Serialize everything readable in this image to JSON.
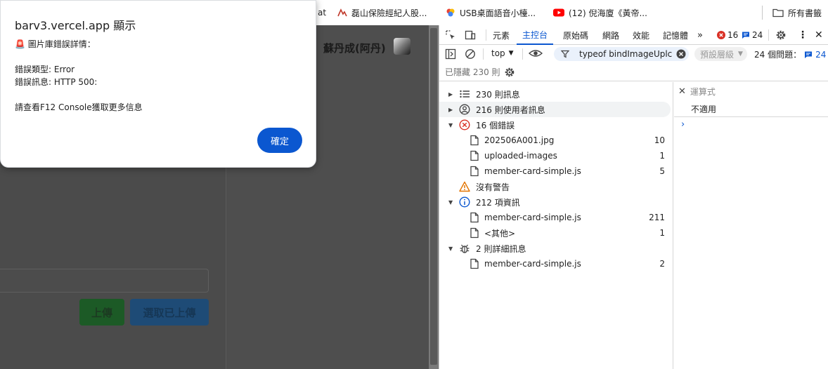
{
  "bookmarks": {
    "items": [
      {
        "label": "at"
      },
      {
        "label": "磊山保險經紀人股..."
      },
      {
        "label": "USB桌面語音小檯..."
      },
      {
        "label": "(12) 倪海廈《黃帝..."
      }
    ],
    "all_bookmarks": "所有書籤"
  },
  "page": {
    "user_name": "蘇丹成(阿丹)",
    "upload_label": "上傳",
    "choose_upload_label": "選取已上傳"
  },
  "dialog": {
    "title": "barv3.vercel.app 顯示",
    "line1": "🚨 圖片庫錯誤詳情：",
    "line2": "錯誤類型: Error",
    "line3": "錯誤訊息: HTTP 500:",
    "line4": "請查看F12 Console獲取更多信息",
    "ok_label": "確定"
  },
  "devtools": {
    "tabs": [
      "元素",
      "主控台",
      "原始碼",
      "網路",
      "效能",
      "記憶體"
    ],
    "active_tab": "主控台",
    "error_count": "16",
    "issue_count": "24",
    "context": "top",
    "filter_text": "typeof bindImageUplc",
    "levels_label": "預設層級",
    "issues_label": "24 個問題：",
    "issues_count_badge": "24",
    "hidden_label": "已隱藏 230 則",
    "sidebar": {
      "messages": "230 則訊息",
      "user_messages": "216 則使用者訊息",
      "errors": "16 個錯誤",
      "error_files": [
        {
          "name": "202506A001.jpg",
          "count": "10"
        },
        {
          "name": "uploaded-images",
          "count": "1"
        },
        {
          "name": "member-card-simple.js",
          "count": "5"
        }
      ],
      "warnings": "沒有警告",
      "info": "212 項資訊",
      "info_files": [
        {
          "name": "member-card-simple.js",
          "count": "211"
        },
        {
          "name": "<其他>",
          "count": "1"
        }
      ],
      "verbose": "2 則詳細訊息",
      "verbose_files": [
        {
          "name": "member-card-simple.js",
          "count": "2"
        }
      ]
    },
    "expression": {
      "header": "運算式",
      "value": "不適用"
    }
  },
  "colors": {
    "accent": "#0b57d0",
    "error": "#d93025",
    "warning": "#e37400",
    "info": "#0b57d0"
  }
}
